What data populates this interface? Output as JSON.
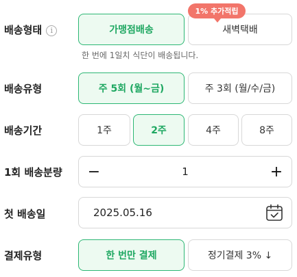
{
  "delivery_type": {
    "label": "배송형태",
    "info_icon": "i",
    "options": [
      "가맹점배송",
      "새벽택배"
    ],
    "selected": 0,
    "badge": "1% 추가적립",
    "note": "한 번에 1일치 식단이 배송됩니다."
  },
  "delivery_kind": {
    "label": "배송유형",
    "options": [
      "주 5회 (월~금)",
      "주 3회 (월/수/금)"
    ],
    "selected": 0
  },
  "delivery_period": {
    "label": "배송기간",
    "options": [
      "1주",
      "2주",
      "4주",
      "8주"
    ],
    "selected": 1
  },
  "quantity": {
    "label": "1회 배송분량",
    "minus": "−",
    "value": "1",
    "plus": "+"
  },
  "first_delivery": {
    "label": "첫 배송일",
    "date": "2025.05.16"
  },
  "payment_type": {
    "label": "결제유형",
    "options": [
      "한 번만 결제",
      "정기결제 3% ↓"
    ],
    "selected": 0
  },
  "colors": {
    "accent_green": "#1ea761",
    "selected_bg": "#edfaf1",
    "badge_red": "#f2756a"
  }
}
